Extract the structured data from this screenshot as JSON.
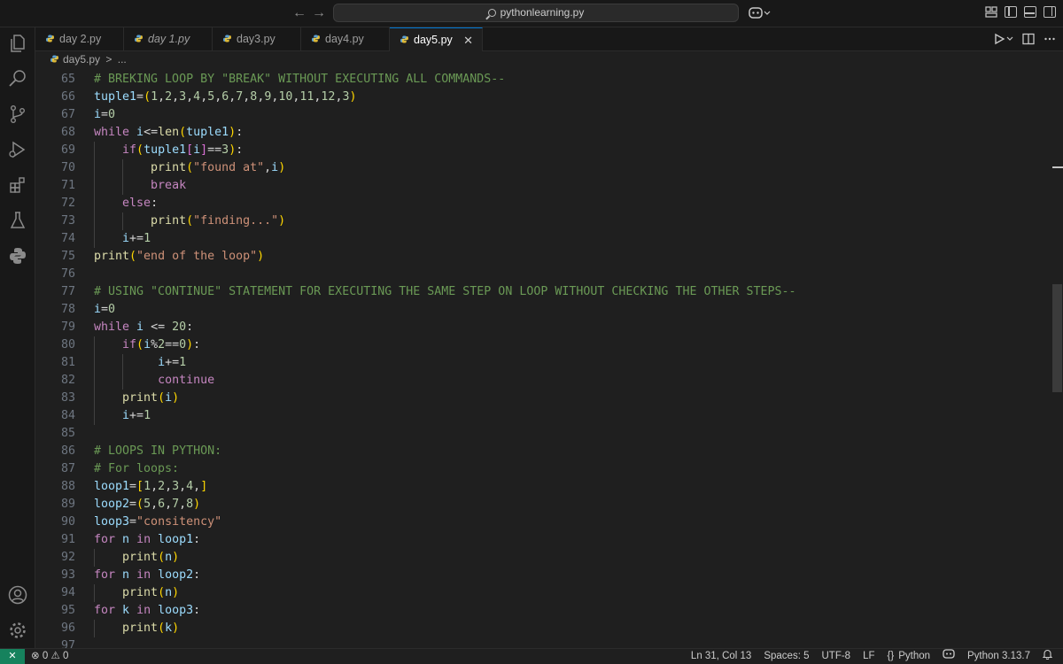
{
  "titlebar": {
    "back": "←",
    "forward": "→",
    "search_text": "pythonlearning.py"
  },
  "tabs": [
    {
      "label": "day 2.py",
      "italic": false
    },
    {
      "label": "day 1.py",
      "italic": true
    },
    {
      "label": "day3.py",
      "italic": false
    },
    {
      "label": "day4.py",
      "italic": false
    },
    {
      "label": "day5.py",
      "italic": false,
      "active": true,
      "close": "✕"
    }
  ],
  "breadcrumb": {
    "file": "day5.py",
    "sep": ">",
    "rest": "..."
  },
  "editor": {
    "lines": [
      {
        "num": "65",
        "indent": 0,
        "tokens": [
          [
            "c",
            "# BREKING LOOP BY \"BREAK\" WITHOUT EXECUTING ALL COMMANDS--"
          ]
        ]
      },
      {
        "num": "66",
        "indent": 0,
        "tokens": [
          [
            "v",
            "tuple1"
          ],
          [
            "o",
            "="
          ],
          [
            "p1",
            "("
          ],
          [
            "n",
            "1"
          ],
          [
            "o",
            ","
          ],
          [
            "n",
            "2"
          ],
          [
            "o",
            ","
          ],
          [
            "n",
            "3"
          ],
          [
            "o",
            ","
          ],
          [
            "n",
            "4"
          ],
          [
            "o",
            ","
          ],
          [
            "n",
            "5"
          ],
          [
            "o",
            ","
          ],
          [
            "n",
            "6"
          ],
          [
            "o",
            ","
          ],
          [
            "n",
            "7"
          ],
          [
            "o",
            ","
          ],
          [
            "n",
            "8"
          ],
          [
            "o",
            ","
          ],
          [
            "n",
            "9"
          ],
          [
            "o",
            ","
          ],
          [
            "n",
            "10"
          ],
          [
            "o",
            ","
          ],
          [
            "n",
            "11"
          ],
          [
            "o",
            ","
          ],
          [
            "n",
            "12"
          ],
          [
            "o",
            ","
          ],
          [
            "n",
            "3"
          ],
          [
            "p1",
            ")"
          ]
        ]
      },
      {
        "num": "67",
        "indent": 0,
        "tokens": [
          [
            "v",
            "i"
          ],
          [
            "o",
            "="
          ],
          [
            "n",
            "0"
          ]
        ]
      },
      {
        "num": "68",
        "indent": 0,
        "tokens": [
          [
            "k",
            "while"
          ],
          [
            "o",
            " "
          ],
          [
            "v",
            "i"
          ],
          [
            "o",
            "<="
          ],
          [
            "fn",
            "len"
          ],
          [
            "p1",
            "("
          ],
          [
            "v",
            "tuple1"
          ],
          [
            "p1",
            ")"
          ],
          [
            "o",
            ":"
          ]
        ]
      },
      {
        "num": "69",
        "indent": 1,
        "tokens": [
          [
            "k",
            "if"
          ],
          [
            "p1",
            "("
          ],
          [
            "v",
            "tuple1"
          ],
          [
            "p2",
            "["
          ],
          [
            "v",
            "i"
          ],
          [
            "p2",
            "]"
          ],
          [
            "o",
            "=="
          ],
          [
            "n",
            "3"
          ],
          [
            "p1",
            ")"
          ],
          [
            "o",
            ":"
          ]
        ]
      },
      {
        "num": "70",
        "indent": 2,
        "tokens": [
          [
            "fn",
            "print"
          ],
          [
            "p1",
            "("
          ],
          [
            "s",
            "\"found at\""
          ],
          [
            "o",
            ","
          ],
          [
            "v",
            "i"
          ],
          [
            "p1",
            ")"
          ]
        ]
      },
      {
        "num": "71",
        "indent": 2,
        "tokens": [
          [
            "k",
            "break"
          ]
        ]
      },
      {
        "num": "72",
        "indent": 1,
        "tokens": [
          [
            "k",
            "else"
          ],
          [
            "o",
            ":"
          ]
        ]
      },
      {
        "num": "73",
        "indent": 2,
        "tokens": [
          [
            "fn",
            "print"
          ],
          [
            "p1",
            "("
          ],
          [
            "s",
            "\"finding...\""
          ],
          [
            "p1",
            ")"
          ]
        ]
      },
      {
        "num": "74",
        "indent": 1,
        "tokens": [
          [
            "v",
            "i"
          ],
          [
            "o",
            "+="
          ],
          [
            "n",
            "1"
          ]
        ]
      },
      {
        "num": "75",
        "indent": 0,
        "tokens": [
          [
            "fn",
            "print"
          ],
          [
            "p1",
            "("
          ],
          [
            "s",
            "\"end of the loop\""
          ],
          [
            "p1",
            ")"
          ]
        ]
      },
      {
        "num": "76",
        "indent": 0,
        "tokens": []
      },
      {
        "num": "77",
        "indent": 0,
        "tokens": [
          [
            "c",
            "# USING \"CONTINUE\" STATEMENT FOR EXECUTING THE SAME STEP ON LOOP WITHOUT CHECKING THE OTHER STEPS--"
          ]
        ]
      },
      {
        "num": "78",
        "indent": 0,
        "tokens": [
          [
            "v",
            "i"
          ],
          [
            "o",
            "="
          ],
          [
            "n",
            "0"
          ]
        ]
      },
      {
        "num": "79",
        "indent": 0,
        "tokens": [
          [
            "k",
            "while"
          ],
          [
            "o",
            " "
          ],
          [
            "v",
            "i"
          ],
          [
            "o",
            " <= "
          ],
          [
            "n",
            "20"
          ],
          [
            "o",
            ":"
          ]
        ]
      },
      {
        "num": "80",
        "indent": 1,
        "tokens": [
          [
            "k",
            "if"
          ],
          [
            "p1",
            "("
          ],
          [
            "v",
            "i"
          ],
          [
            "o",
            "%"
          ],
          [
            "n",
            "2"
          ],
          [
            "o",
            "=="
          ],
          [
            "n",
            "0"
          ],
          [
            "p1",
            ")"
          ],
          [
            "o",
            ":"
          ]
        ]
      },
      {
        "num": "81",
        "indent": 2,
        "extra": " ",
        "tokens": [
          [
            "v",
            "i"
          ],
          [
            "o",
            "+="
          ],
          [
            "n",
            "1"
          ]
        ]
      },
      {
        "num": "82",
        "indent": 2,
        "extra": " ",
        "tokens": [
          [
            "k",
            "continue"
          ]
        ]
      },
      {
        "num": "83",
        "indent": 1,
        "tokens": [
          [
            "fn",
            "print"
          ],
          [
            "p1",
            "("
          ],
          [
            "v",
            "i"
          ],
          [
            "p1",
            ")"
          ]
        ]
      },
      {
        "num": "84",
        "indent": 1,
        "tokens": [
          [
            "v",
            "i"
          ],
          [
            "o",
            "+="
          ],
          [
            "n",
            "1"
          ]
        ]
      },
      {
        "num": "85",
        "indent": 0,
        "tokens": []
      },
      {
        "num": "86",
        "indent": 0,
        "tokens": [
          [
            "c",
            "# LOOPS IN PYTHON:"
          ]
        ]
      },
      {
        "num": "87",
        "indent": 0,
        "tokens": [
          [
            "c",
            "# For loops:"
          ]
        ]
      },
      {
        "num": "88",
        "indent": 0,
        "tokens": [
          [
            "v",
            "loop1"
          ],
          [
            "o",
            "="
          ],
          [
            "p1",
            "["
          ],
          [
            "n",
            "1"
          ],
          [
            "o",
            ","
          ],
          [
            "n",
            "2"
          ],
          [
            "o",
            ","
          ],
          [
            "n",
            "3"
          ],
          [
            "o",
            ","
          ],
          [
            "n",
            "4"
          ],
          [
            "o",
            ","
          ],
          [
            "p1",
            "]"
          ]
        ]
      },
      {
        "num": "89",
        "indent": 0,
        "tokens": [
          [
            "v",
            "loop2"
          ],
          [
            "o",
            "="
          ],
          [
            "p1",
            "("
          ],
          [
            "n",
            "5"
          ],
          [
            "o",
            ","
          ],
          [
            "n",
            "6"
          ],
          [
            "o",
            ","
          ],
          [
            "n",
            "7"
          ],
          [
            "o",
            ","
          ],
          [
            "n",
            "8"
          ],
          [
            "p1",
            ")"
          ]
        ]
      },
      {
        "num": "90",
        "indent": 0,
        "tokens": [
          [
            "v",
            "loop3"
          ],
          [
            "o",
            "="
          ],
          [
            "s",
            "\"consitency\""
          ]
        ]
      },
      {
        "num": "91",
        "indent": 0,
        "tokens": [
          [
            "k",
            "for"
          ],
          [
            "o",
            " "
          ],
          [
            "v",
            "n"
          ],
          [
            "o",
            " "
          ],
          [
            "k",
            "in"
          ],
          [
            "o",
            " "
          ],
          [
            "v",
            "loop1"
          ],
          [
            "o",
            ":"
          ]
        ]
      },
      {
        "num": "92",
        "indent": 1,
        "tokens": [
          [
            "fn",
            "print"
          ],
          [
            "p1",
            "("
          ],
          [
            "v",
            "n"
          ],
          [
            "p1",
            ")"
          ]
        ]
      },
      {
        "num": "93",
        "indent": 0,
        "tokens": [
          [
            "k",
            "for"
          ],
          [
            "o",
            " "
          ],
          [
            "v",
            "n"
          ],
          [
            "o",
            " "
          ],
          [
            "k",
            "in"
          ],
          [
            "o",
            " "
          ],
          [
            "v",
            "loop2"
          ],
          [
            "o",
            ":"
          ]
        ]
      },
      {
        "num": "94",
        "indent": 1,
        "tokens": [
          [
            "fn",
            "print"
          ],
          [
            "p1",
            "("
          ],
          [
            "v",
            "n"
          ],
          [
            "p1",
            ")"
          ]
        ]
      },
      {
        "num": "95",
        "indent": 0,
        "tokens": [
          [
            "k",
            "for"
          ],
          [
            "o",
            " "
          ],
          [
            "v",
            "k"
          ],
          [
            "o",
            " "
          ],
          [
            "k",
            "in"
          ],
          [
            "o",
            " "
          ],
          [
            "v",
            "loop3"
          ],
          [
            "o",
            ":"
          ]
        ]
      },
      {
        "num": "96",
        "indent": 1,
        "tokens": [
          [
            "fn",
            "print"
          ],
          [
            "p1",
            "("
          ],
          [
            "v",
            "k"
          ],
          [
            "p1",
            ")"
          ]
        ]
      },
      {
        "num": "97",
        "indent": 0,
        "tokens": []
      }
    ]
  },
  "statusbar": {
    "remote": "✕",
    "errors": "0",
    "warnings": "0",
    "position": "Ln 31, Col 13",
    "spaces": "Spaces: 5",
    "encoding": "UTF-8",
    "eol": "LF",
    "language": "Python",
    "interpreter": "Python 3.13.7"
  },
  "colors": {
    "accent": "#0078d4",
    "remote_bg": "#16825d",
    "comment": "#6a9955",
    "keyword": "#c586c0",
    "string": "#ce9178"
  }
}
